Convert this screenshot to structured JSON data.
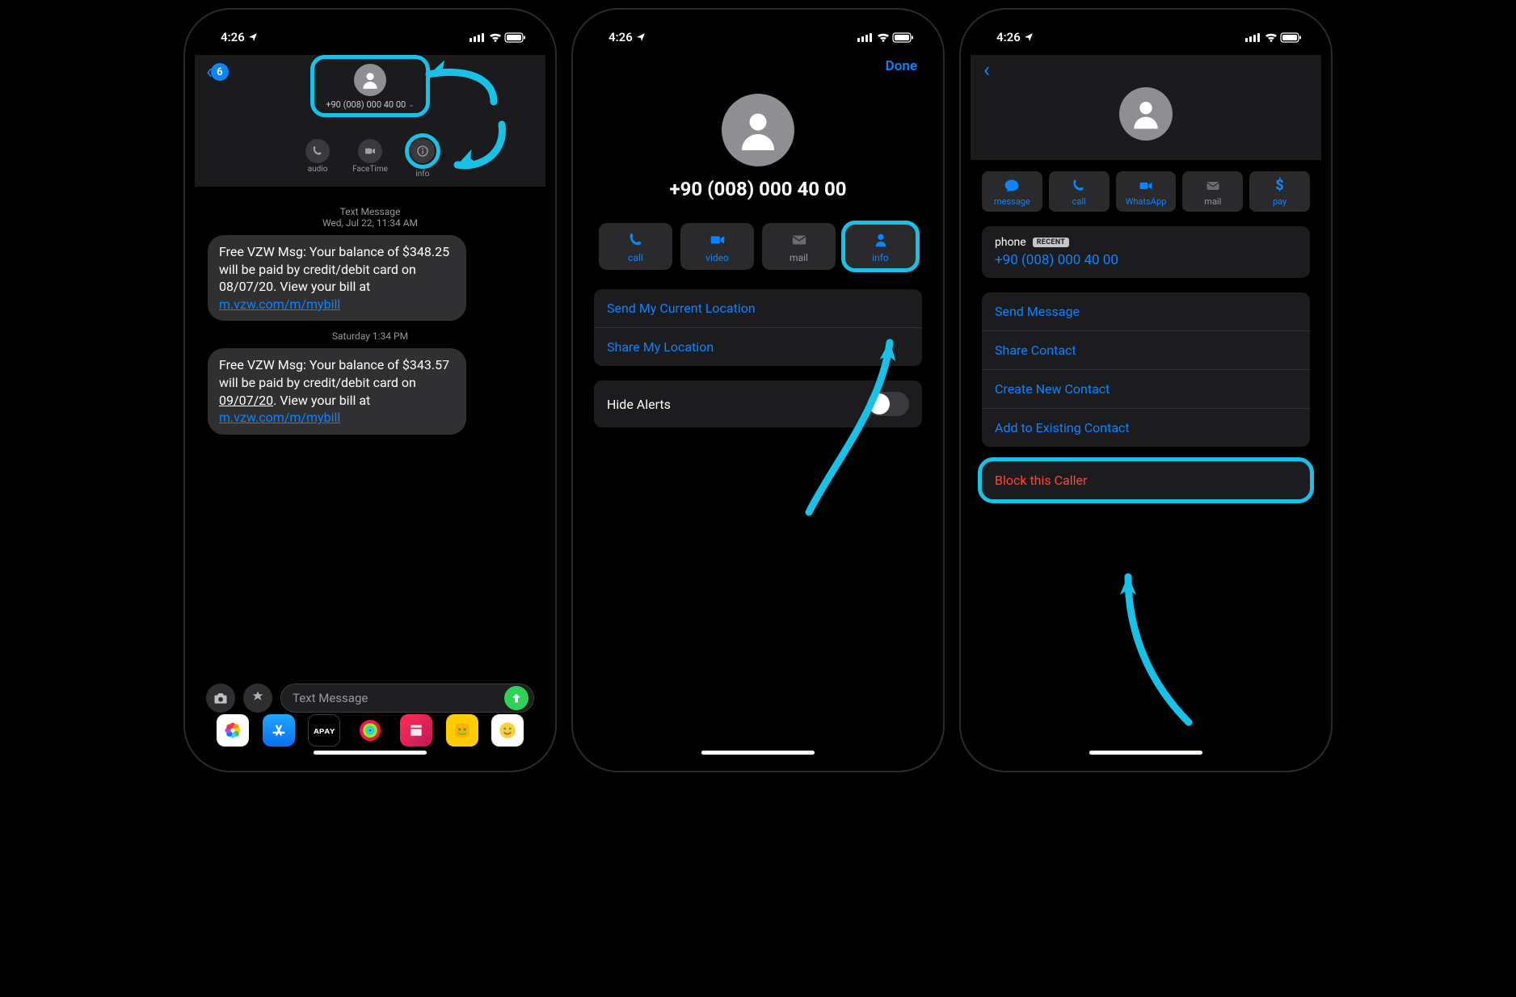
{
  "status": {
    "time": "4:26",
    "location_arrow": "➤"
  },
  "screen1": {
    "back_count": "6",
    "contact_number": "+90 (008) 000 40 00",
    "actions": {
      "audio": "audio",
      "facetime": "FaceTime",
      "info": "info"
    },
    "ts1_line1": "Text Message",
    "ts1_line2": "Wed, Jul 22, 11:34 AM",
    "msg1_pre": "Free VZW Msg: Your balance of $348.25 will be paid by credit/debit card on 08/07/20. View your bill at ",
    "msg1_link": "m.vzw.com/m/mybill",
    "ts2": "Saturday 1:34 PM",
    "msg2_a": "Free VZW Msg: Your balance of $343.57 will be paid by credit/debit card on ",
    "msg2_date": "09/07/20",
    "msg2_b": ". View your bill at ",
    "msg2_link": "m.vzw.com/m/mybill",
    "placeholder": "Text Message",
    "apps": {
      "photos_label": "Photos",
      "appstore_label": "App Store",
      "applepay_label": "Apple Pay",
      "activity_label": "Activity",
      "app5_label": "App",
      "memoji_label": "Memoji",
      "animoji_label": "Animoji",
      "applepay_text": "ᴀᴘᴀʏ"
    }
  },
  "screen2": {
    "done": "Done",
    "number": "+90 (008) 000 40 00",
    "btns": {
      "call": "call",
      "video": "video",
      "mail": "mail",
      "info": "info"
    },
    "send_location": "Send My Current Location",
    "share_location": "Share My Location",
    "hide_alerts": "Hide Alerts"
  },
  "screen3": {
    "btns": {
      "message": "message",
      "call": "call",
      "whatsapp": "WhatsApp",
      "mail": "mail",
      "pay": "pay"
    },
    "phone_label": "phone",
    "recent": "RECENT",
    "phone_value": "+90 (008) 000 40 00",
    "send_message": "Send Message",
    "share_contact": "Share Contact",
    "create_contact": "Create New Contact",
    "add_existing": "Add to Existing Contact",
    "block": "Block this Caller"
  }
}
